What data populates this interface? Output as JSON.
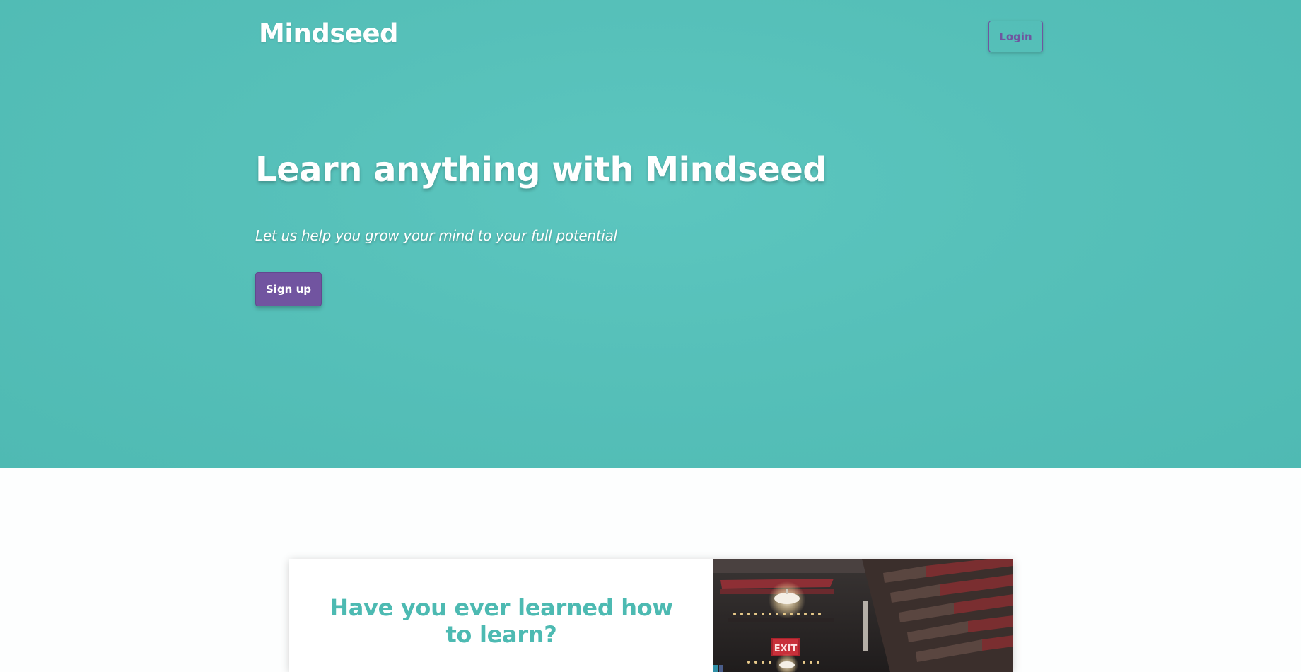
{
  "header": {
    "brand": "Mindseed",
    "login_label": "Login"
  },
  "hero": {
    "headline": "Learn anything with Mindseed",
    "subline": "Let us help you grow your mind to your full potential",
    "signup_label": "Sign up"
  },
  "feature_card": {
    "title": "Have you ever learned how to learn?",
    "photo_description_icon": "library-photo",
    "photo_sign_text": "EXIT"
  },
  "colors": {
    "hero_background": "#56c0b9",
    "accent_purple": "#7154a0",
    "heading_teal": "#4dbab2"
  }
}
